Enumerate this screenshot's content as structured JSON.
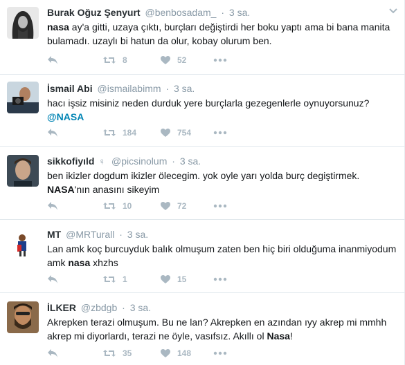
{
  "tweets": [
    {
      "fullname": "Burak Oğuz Şenyurt",
      "username": "@benbosadam_",
      "time": "3 sa.",
      "text_parts": [
        {
          "t": "nasa",
          "style": "bold"
        },
        {
          "t": " ay'a gitti, uzaya çıktı, burçları değiştirdi her boku yaptı ama bi bana manita bulamadı. uzaylı bi hatun da olur, kobay olurum ben.",
          "style": "plain"
        }
      ],
      "retweets": "8",
      "likes": "52",
      "avatar_icon": "avatar-long-hair-bw"
    },
    {
      "fullname": "İsmail Abi",
      "username": "@ismailabimm",
      "time": "3 sa.",
      "text_parts": [
        {
          "t": "hacı işsiz misiniz neden durduk yere burçlarla gezegenlerle oynuyorsunuz? ",
          "style": "plain"
        },
        {
          "t": "@NASA",
          "style": "mention"
        }
      ],
      "retweets": "184",
      "likes": "754",
      "avatar_icon": "avatar-man-with-camera"
    },
    {
      "fullname": "sikkofiyıld",
      "gender_icon": "♀",
      "username": "@picsinolum",
      "time": "3 sa.",
      "text_parts": [
        {
          "t": "ben ikizler dogdum ikizler ölecegim. yok oyle yarı yolda burç degiştirmek. ",
          "style": "plain"
        },
        {
          "t": "NASA",
          "style": "bold"
        },
        {
          "t": "'nın anasını sikeyim",
          "style": "plain"
        }
      ],
      "retweets": "10",
      "likes": "72",
      "avatar_icon": "avatar-young-man"
    },
    {
      "fullname": "MT",
      "username": "@MRTurall",
      "time": "3 sa.",
      "text_parts": [
        {
          "t": "Lan amk koç burcuyduk balık  olmuşum zaten ben hiç  biri olduğuma inanmiyodum amk ",
          "style": "plain"
        },
        {
          "t": "nasa",
          "style": "bold"
        },
        {
          "t": " xhzhs",
          "style": "plain"
        }
      ],
      "retweets": "1",
      "likes": "15",
      "avatar_icon": "avatar-small-figure"
    },
    {
      "fullname": "İLKER",
      "username": "@zbdgb",
      "time": "3 sa.",
      "text_parts": [
        {
          "t": "Akrepken terazi olmuşum. Bu ne lan? Akrepken en azından ıyy akrep mi mmhh akrep mi diyorlardı, terazi ne öyle, vasıfsız. Akıllı ol ",
          "style": "plain"
        },
        {
          "t": "Nasa",
          "style": "bold"
        },
        {
          "t": "!",
          "style": "plain"
        }
      ],
      "retweets": "35",
      "likes": "148",
      "avatar_icon": "avatar-bearded-man"
    }
  ],
  "colors": {
    "text": "#14171a",
    "meta": "#8899a6",
    "action": "#aab8c2",
    "mention": "#0084b4",
    "divider": "#e1e8ed"
  }
}
